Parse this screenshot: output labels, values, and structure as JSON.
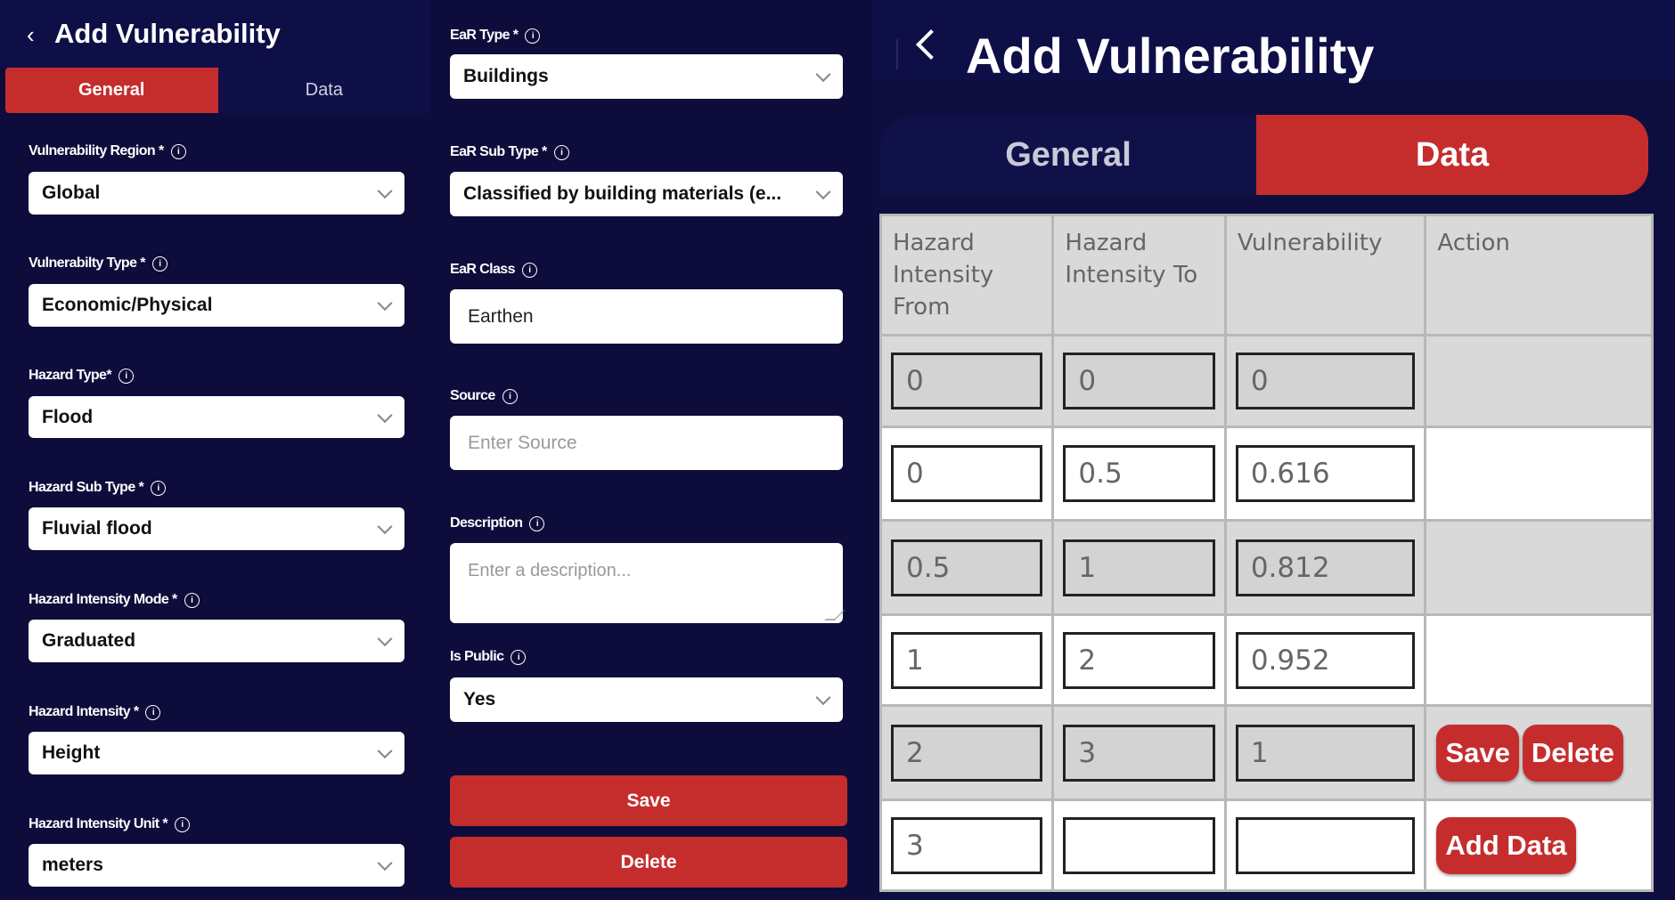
{
  "left": {
    "header": {
      "back_icon": "chevron-left-icon",
      "title": "Add Vulnerability"
    },
    "tabs": [
      {
        "label": "General",
        "active": true
      },
      {
        "label": "Data",
        "active": false
      }
    ],
    "fields": {
      "region": {
        "label": "Vulnerability Region *",
        "value": "Global"
      },
      "vtype": {
        "label": "Vulnerabilty Type *",
        "value": "Economic/Physical"
      },
      "hazard_type": {
        "label": "Hazard Type*",
        "value": "Flood"
      },
      "hazard_sub": {
        "label": "Hazard Sub Type *",
        "value": "Fluvial flood"
      },
      "intensity_mode": {
        "label": "Hazard Intensity Mode *",
        "value": "Graduated"
      },
      "intensity": {
        "label": "Hazard Intensity *",
        "value": "Height"
      },
      "intensity_unit": {
        "label": "Hazard Intensity Unit *",
        "value": "meters"
      },
      "ear_type": {
        "label": "EaR Type *",
        "value": "Buildings"
      },
      "ear_sub": {
        "label": "EaR Sub Type *",
        "value": "Classified by building materials (e..."
      },
      "ear_class": {
        "label": "EaR Class",
        "value": "Earthen"
      },
      "source": {
        "label": "Source",
        "placeholder": "Enter Source"
      },
      "description": {
        "label": "Description",
        "placeholder": "Enter a description..."
      },
      "is_public": {
        "label": "Is Public",
        "value": "Yes"
      }
    },
    "buttons": {
      "save": "Save",
      "delete": "Delete"
    }
  },
  "right": {
    "header": {
      "back_icon": "chevron-left-icon",
      "title": "Add Vulnerability"
    },
    "tabs": [
      {
        "label": "General",
        "active": false
      },
      {
        "label": "Data",
        "active": true
      }
    ],
    "table": {
      "headers": [
        "Hazard Intensity From",
        "Hazard Intensity To",
        "Vulnerability",
        "Action"
      ],
      "rows": [
        {
          "from": "0",
          "to": "0",
          "vuln": "0",
          "shade": "grey"
        },
        {
          "from": "0",
          "to": "0.5",
          "vuln": "0.616",
          "shade": "white"
        },
        {
          "from": "0.5",
          "to": "1",
          "vuln": "0.812",
          "shade": "grey"
        },
        {
          "from": "1",
          "to": "2",
          "vuln": "0.952",
          "shade": "white"
        },
        {
          "from": "2",
          "to": "3",
          "vuln": "1",
          "shade": "grey",
          "actions": [
            "Save",
            "Delete"
          ]
        },
        {
          "from": "3",
          "to": "",
          "vuln": "",
          "shade": "white",
          "actions": [
            "Add Data"
          ]
        }
      ]
    }
  },
  "colors": {
    "accent": "#c52d2d",
    "background": "#0d0c3b",
    "header": "#0f0f48"
  }
}
